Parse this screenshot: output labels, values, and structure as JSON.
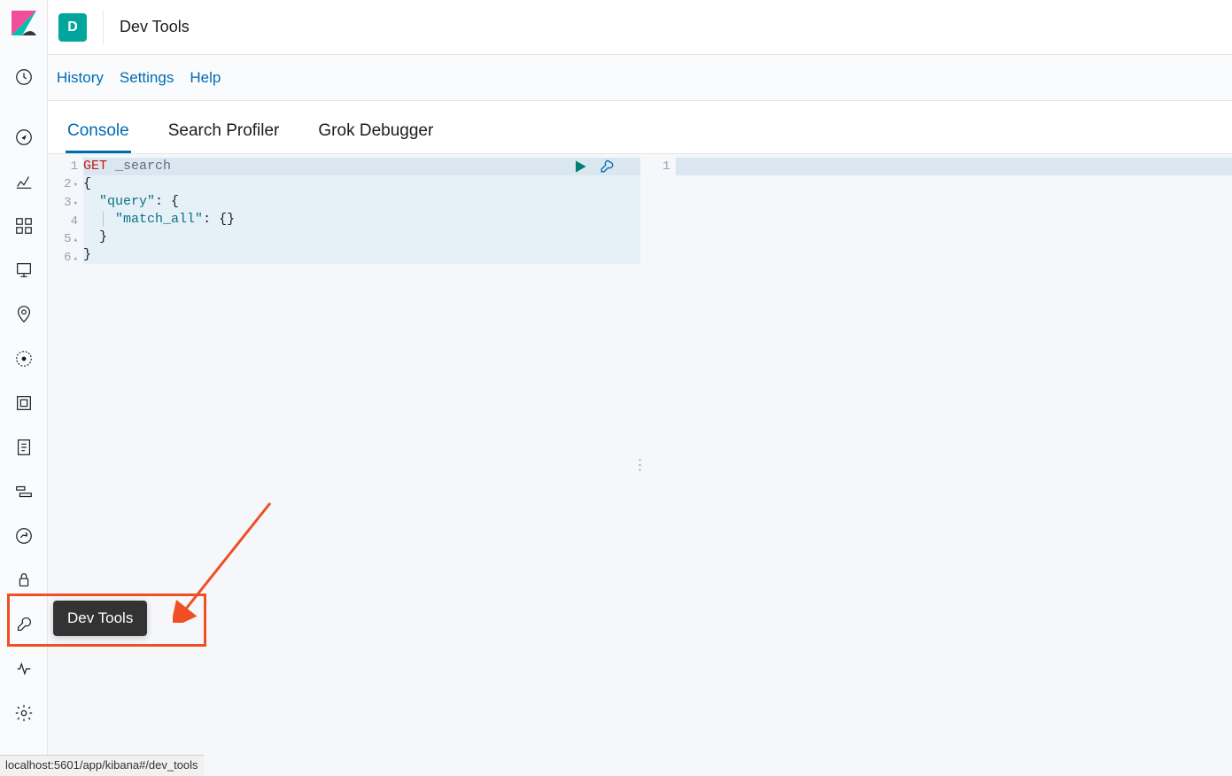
{
  "header": {
    "space_initial": "D",
    "title": "Dev Tools"
  },
  "subnav": {
    "history": "History",
    "settings": "Settings",
    "help": "Help"
  },
  "tabs": {
    "console": "Console",
    "search_profiler": "Search Profiler",
    "grok_debugger": "Grok Debugger"
  },
  "editor": {
    "request_line": {
      "verb": "GET",
      "path": "_search"
    },
    "line2": "{",
    "line3_key": "\"query\"",
    "line3_rest": ": {",
    "line4_key": "\"match_all\"",
    "line4_rest": ": {}",
    "line5": "  }",
    "line6": "}",
    "line_numbers": [
      "1",
      "2",
      "3",
      "4",
      "5",
      "6"
    ]
  },
  "output": {
    "line_numbers": [
      "1"
    ]
  },
  "tooltip": {
    "label": "Dev Tools"
  },
  "statusbar": {
    "url": "localhost:5601/app/kibana#/dev_tools"
  },
  "colors": {
    "accent": "#006bb4",
    "teal": "#00a69b",
    "run_green": "#017d73",
    "annotation": "#f04e23"
  }
}
